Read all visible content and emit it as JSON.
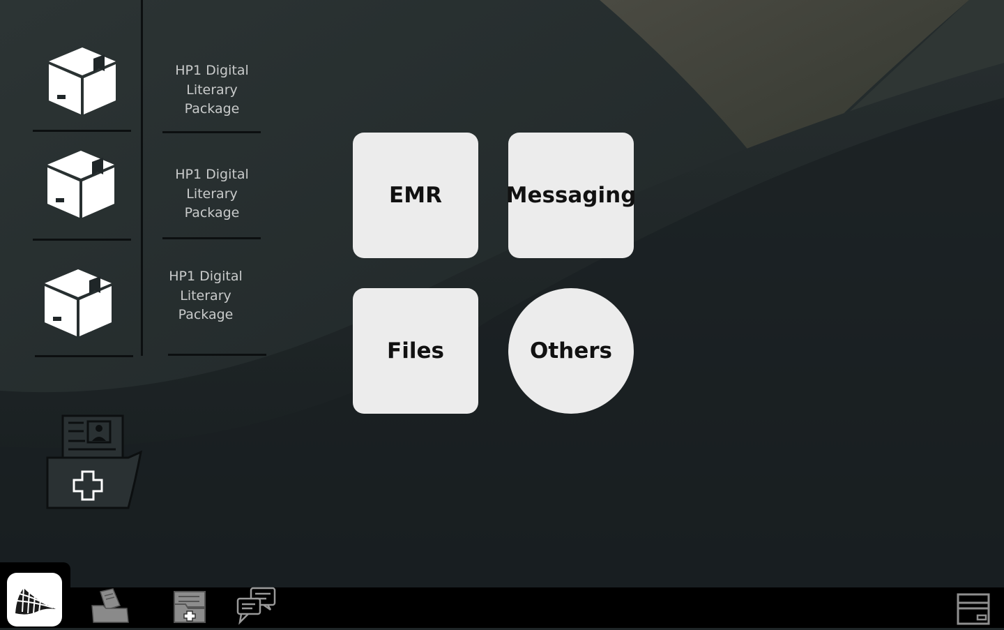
{
  "desktop": {
    "packages": [
      {
        "label": "HP1 Digital Literary Package",
        "icon": "package-box-icon"
      },
      {
        "label": "HP1 Digital Literary Package",
        "icon": "package-box-icon"
      },
      {
        "label": "HP1 Digital Literary Package",
        "icon": "package-box-icon"
      }
    ],
    "records_icon": "medical-records-folder-icon"
  },
  "apps": {
    "emr": "EMR",
    "messaging": "Messaging",
    "files": "Files",
    "others": "Others"
  },
  "taskbar": {
    "start": "start-logo-icon",
    "items": [
      "files-folder-icon",
      "medical-card-icon",
      "chat-icon"
    ],
    "tray": "archive-box-icon"
  },
  "colors": {
    "background": "#1f2628",
    "tile": "#ececec",
    "taskbar": "#000000"
  }
}
